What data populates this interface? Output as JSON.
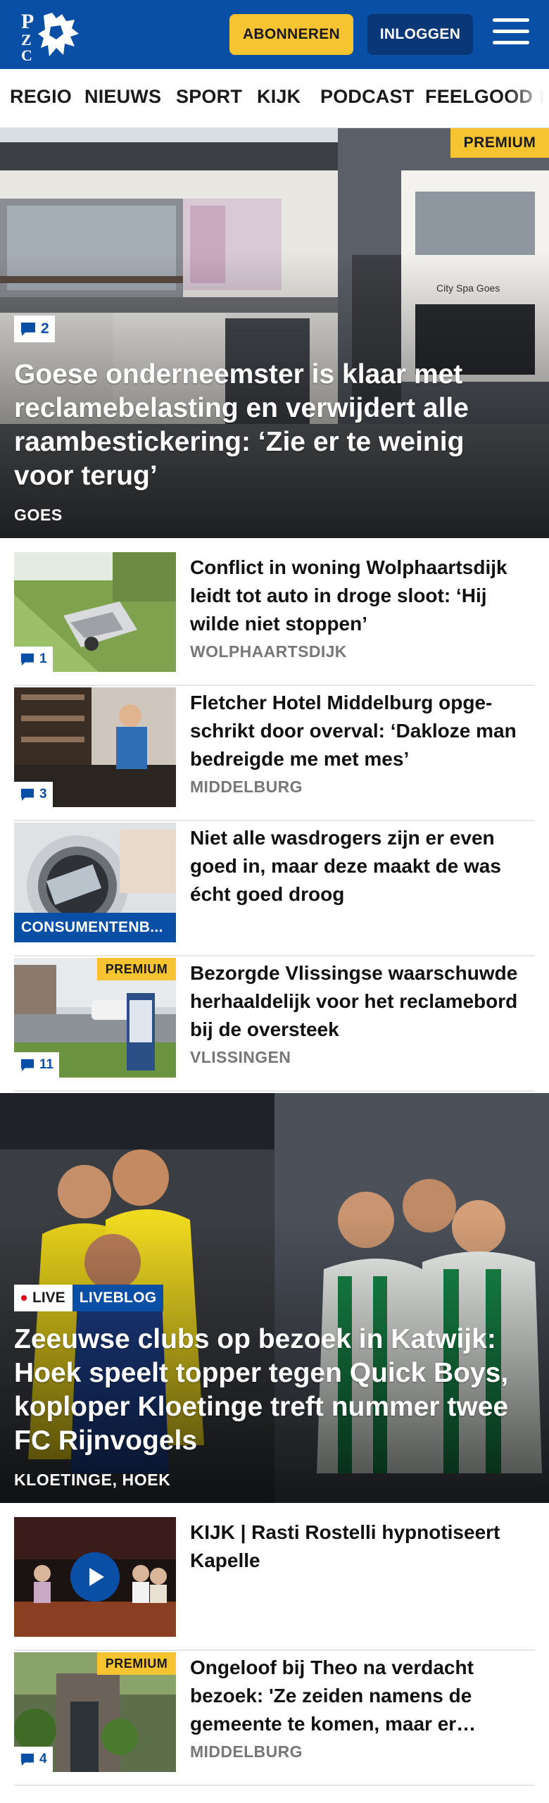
{
  "header": {
    "logo_text": "PZC",
    "subscribe_label": "ABONNEREN",
    "login_label": "INLOGGEN"
  },
  "nav": {
    "items": [
      "REGIO",
      "NIEUWS",
      "SPORT",
      "KIJK",
      "PODCAST",
      "FEELGOOD"
    ]
  },
  "hero1": {
    "badge": "PREMIUM",
    "comments": "2",
    "title": "Goese onderneemster is klaar met reclamebelasting en verwijdert alle raambestickering: ‘Zie er te weinig voor terug’",
    "location": "GOES",
    "shop_sign": "City Spa Goes"
  },
  "articles": [
    {
      "title": "Conflict in woning Wolphaarts­dijk leidt tot auto in droge sloot: ‘Hij wilde niet stoppen’",
      "location": "WOLPHAARTSDIJK",
      "comments": "1"
    },
    {
      "title": "Fletcher Hotel Middelburg opge­schrikt door overval: ‘Dakloze man bedreigde me met mes’",
      "location": "MIDDELBURG",
      "comments": "3"
    },
    {
      "title": "Niet alle wasdrogers zijn er even goed in, maar deze maakt de was écht goed droog",
      "category": "CONSUMENTENB..."
    },
    {
      "title": "Bezorgde Vlissingse waarschuw­de herhaaldelijk voor het reclamebord bij de oversteek",
      "location": "VLISSINGEN",
      "comments": "11",
      "badge": "PREMIUM"
    }
  ],
  "hero2": {
    "live_label": "LIVE",
    "liveblog_label": "LIVEBLOG",
    "title": "Zeeuwse clubs op bezoek in Katwijk: Hoek speelt topper tegen Quick Boys, koploper Kloetinge treft nummer twee FC Rijnvogels",
    "location": "KLOETINGE, HOEK"
  },
  "articles2": [
    {
      "title": "KIJK | Rasti Rostelli hypnotiseert Kapelle"
    },
    {
      "title": "Ongeloof bij Theo na verdacht bezoek: 'Ze zeiden namens de gemeente te komen, maar er…",
      "location": "MIDDELBURG",
      "comments": "4",
      "badge": "PREMIUM"
    }
  ],
  "colors": {
    "brand_blue": "#0a4fa6",
    "premium_yellow": "#f6c431",
    "live_red": "#e2001a"
  }
}
